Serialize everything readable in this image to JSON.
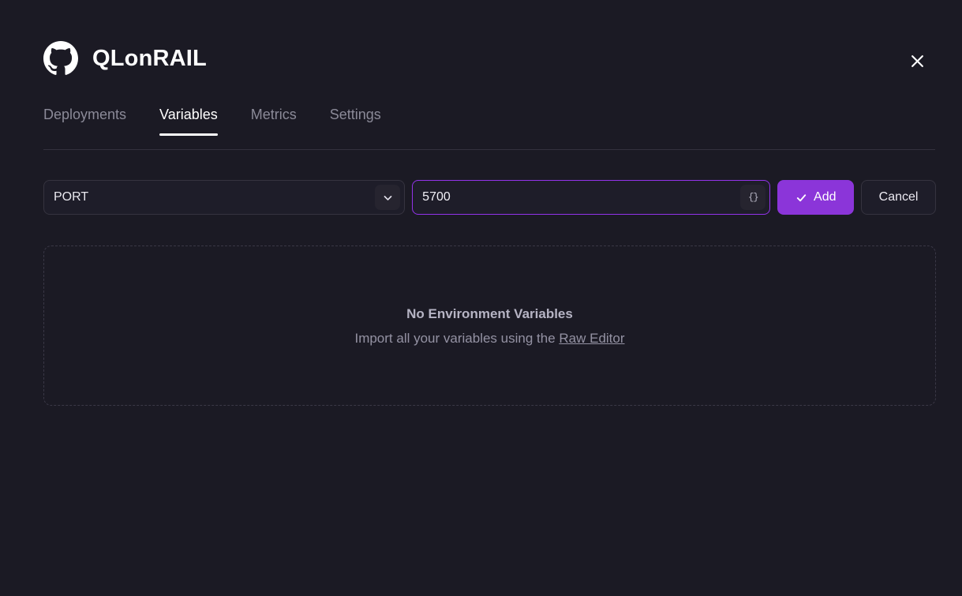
{
  "header": {
    "logo_icon": "github-icon",
    "title": "QLonRAIL",
    "close_icon": "close-icon"
  },
  "tabs": [
    {
      "label": "Deployments",
      "active": false
    },
    {
      "label": "Variables",
      "active": true
    },
    {
      "label": "Metrics",
      "active": false
    },
    {
      "label": "Settings",
      "active": false
    }
  ],
  "form": {
    "key": {
      "value": "PORT",
      "dropdown_icon": "chevron-down-icon"
    },
    "value": {
      "value": "5700",
      "braces_icon": "braces-icon",
      "braces_glyph": "{}",
      "focused": true
    },
    "add_label": "Add",
    "add_icon": "check-icon",
    "cancel_label": "Cancel"
  },
  "empty_state": {
    "title": "No Environment Variables",
    "subtitle_prefix": "Import all your variables using the ",
    "link_label": "Raw Editor"
  },
  "colors": {
    "background": "#1b1a24",
    "accent_purple": "#8b35d9",
    "focus_border": "#9333ea",
    "text_primary": "#ffffff",
    "text_muted": "#8b8a98",
    "panel_border": "#3a3846"
  }
}
